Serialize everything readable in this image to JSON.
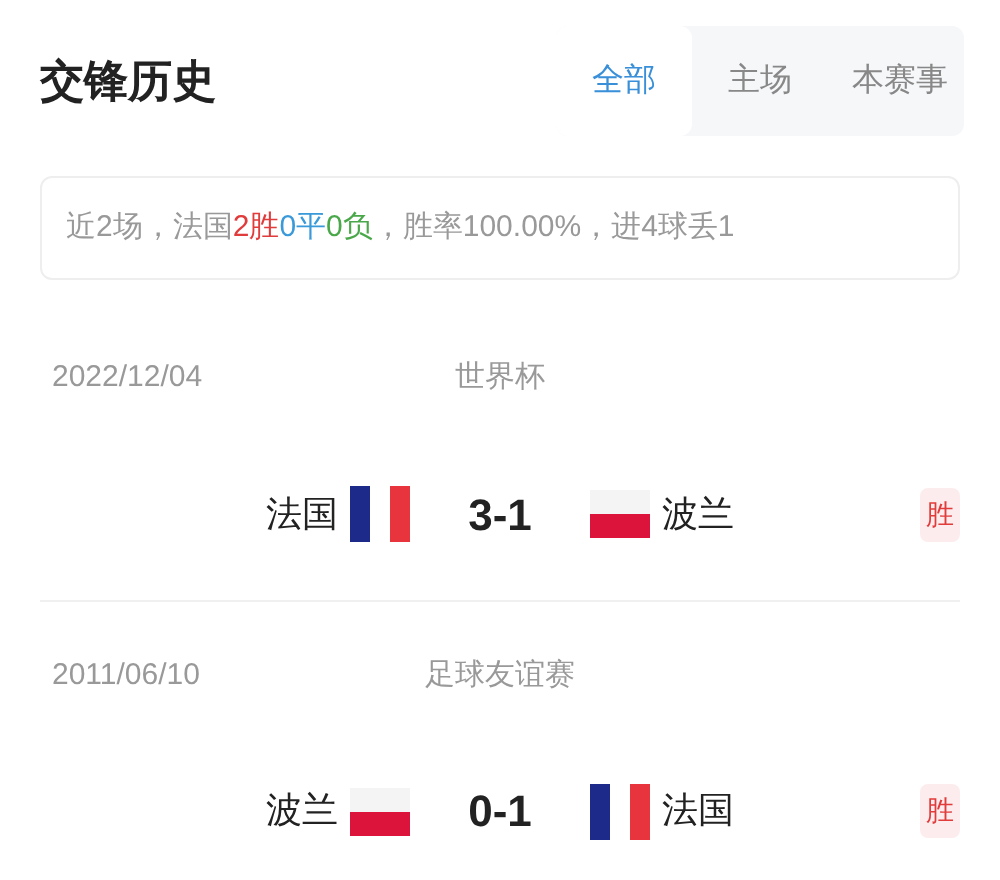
{
  "title": "交锋历史",
  "tabs": [
    {
      "label": "全部",
      "selected": true
    },
    {
      "label": "主场",
      "selected": false
    },
    {
      "label": "本赛事",
      "selected": false
    }
  ],
  "summary": [
    {
      "kind": "plain",
      "text": "近2场，法国"
    },
    {
      "kind": "win",
      "text": "2胜"
    },
    {
      "kind": "draw",
      "text": "0平"
    },
    {
      "kind": "loss",
      "text": "0负"
    },
    {
      "kind": "plain",
      "text": "，胜率100.00%，进4球丢1"
    }
  ],
  "matches": [
    {
      "date": "2022/12/04",
      "competition": "世界杯",
      "home": {
        "name": "法国",
        "flag": {
          "kind": "fr"
        }
      },
      "score": "3-1",
      "away": {
        "name": "波兰",
        "flag": {
          "kind": "pl"
        }
      },
      "result": {
        "kind": "win",
        "text": "胜"
      }
    },
    {
      "date": "2011/06/10",
      "competition": "足球友谊赛",
      "home": {
        "name": "波兰",
        "flag": {
          "kind": "pl"
        }
      },
      "score": "0-1",
      "away": {
        "name": "法国",
        "flag": {
          "kind": "fr"
        }
      },
      "result": {
        "kind": "win",
        "text": "胜"
      }
    }
  ]
}
